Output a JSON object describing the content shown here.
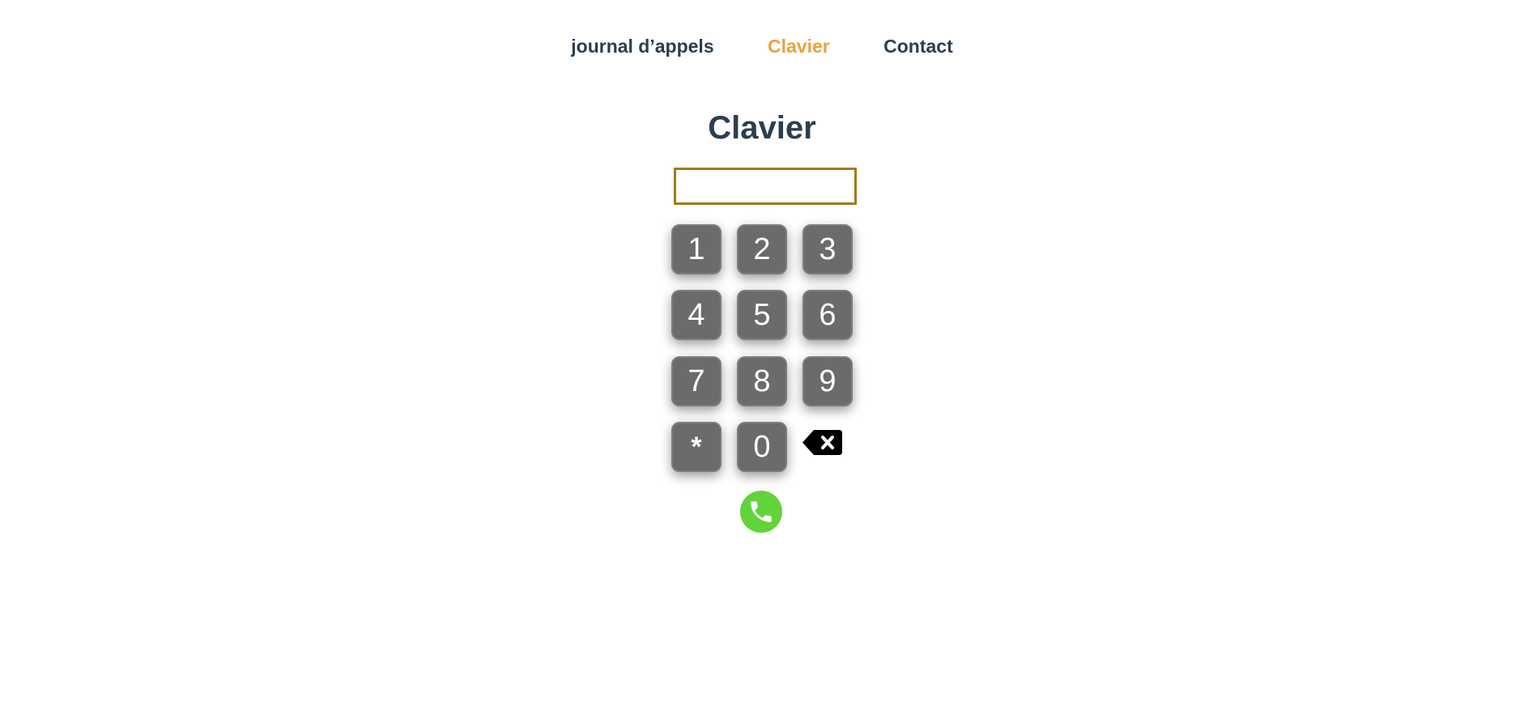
{
  "nav": {
    "items": [
      {
        "label": "journal d’appels",
        "active": false
      },
      {
        "label": "Clavier",
        "active": true
      },
      {
        "label": "Contact",
        "active": false
      }
    ]
  },
  "page": {
    "title": "Clavier"
  },
  "input": {
    "value": "",
    "placeholder": ""
  },
  "keypad": {
    "keys": [
      "1",
      "2",
      "3",
      "4",
      "5",
      "6",
      "7",
      "8",
      "9",
      "*",
      "0"
    ],
    "backspace_icon": "backspace-icon",
    "call_icon": "phone-icon"
  },
  "colors": {
    "accent": "#e9a23b",
    "text": "#2c3e50",
    "input_border": "#a07a1c",
    "key_bg": "#6b6b6b",
    "call_green": "#62d33a"
  }
}
